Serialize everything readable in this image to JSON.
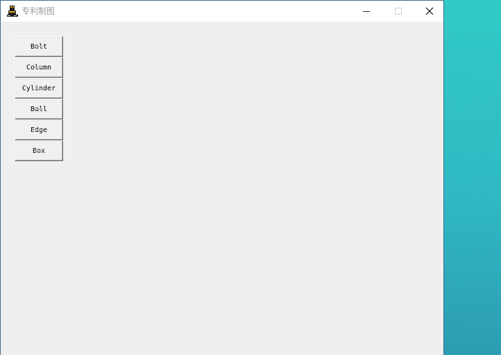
{
  "window": {
    "title": "专利制图",
    "app_icon": "cad-app-icon",
    "controls": {
      "minimize_icon": "minimize-icon",
      "maximize_icon": "maximize-icon",
      "close_icon": "close-icon"
    }
  },
  "buttons": [
    {
      "label": "Bolt"
    },
    {
      "label": "Column"
    },
    {
      "label": "Cylinder"
    },
    {
      "label": "Ball"
    },
    {
      "label": "Edge"
    },
    {
      "label": "Box"
    }
  ],
  "colors": {
    "titlebar_bg": "#ffffff",
    "client_bg": "#efefef",
    "title_text": "#9a9a9a",
    "desktop_accent": "#2fc9c6"
  }
}
